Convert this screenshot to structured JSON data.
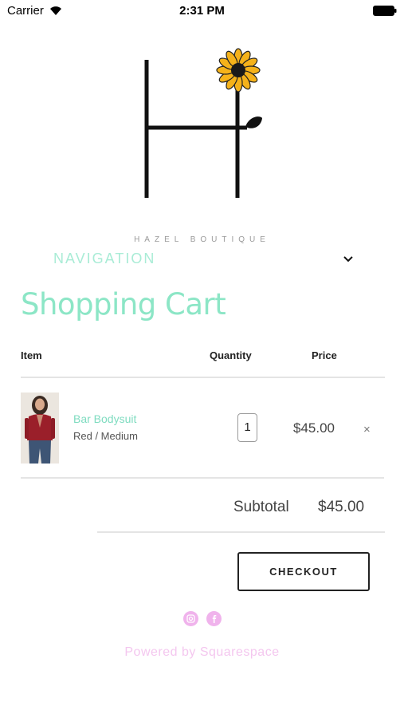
{
  "status_bar": {
    "carrier": "Carrier",
    "time": "2:31 PM",
    "icons": [
      "wifi-icon",
      "battery-icon"
    ]
  },
  "header": {
    "logo_icon": "sunflower-h-logo",
    "brand_name": "HAZEL BOUTIQUE",
    "nav_label": "NAVIGATION",
    "nav_icon": "chevron-down-icon"
  },
  "page": {
    "title": "Shopping Cart"
  },
  "cart": {
    "columns": [
      "Item",
      "Quantity",
      "Price"
    ],
    "items": [
      {
        "name": "Bar Bodysuit",
        "variant": "Red / Medium",
        "quantity": "1",
        "price": "$45.00",
        "remove_label": "×"
      }
    ],
    "subtotal_label": "Subtotal",
    "subtotal_value": "$45.00",
    "checkout_label": "CHECKOUT"
  },
  "footer": {
    "social_icons": [
      "instagram-icon",
      "facebook-icon"
    ],
    "powered_by": "Powered by Squarespace"
  },
  "colors": {
    "accent_mint": "#8ce6c6",
    "social_pink": "#f0b3ec",
    "footer_text_pink": "#f4c7ef"
  }
}
